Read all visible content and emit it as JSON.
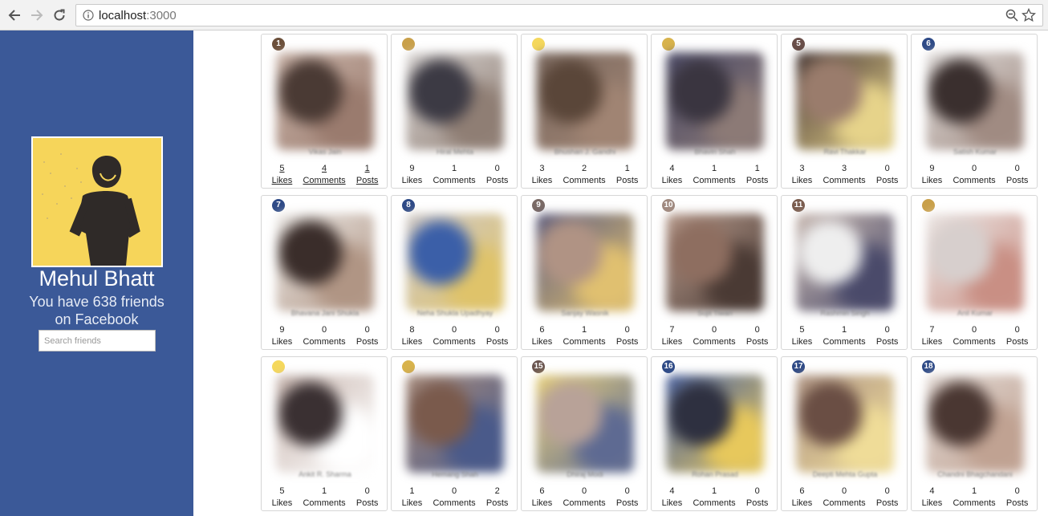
{
  "browser": {
    "url_host": "localhost",
    "url_port": ":3000"
  },
  "profile": {
    "name": "Mehul Bhatt",
    "friends_line1": "You have 638 friends",
    "friends_line2": "on Facebook",
    "search_placeholder": "Search friends"
  },
  "stat_labels": {
    "likes": "Likes",
    "comments": "Comments",
    "posts": "Posts"
  },
  "friends": [
    {
      "badge": "1",
      "badge_color": "#6b4f3a",
      "name": "Vikas Jain",
      "likes": "5",
      "comments": "4",
      "posts": "1",
      "linked": true,
      "palette": [
        "#4a3a34",
        "#9a7b6e",
        "#c9b3a8"
      ]
    },
    {
      "badge": "",
      "badge_color": "#c9a04a",
      "name": "Hiral Mehta",
      "likes": "9",
      "comments": "1",
      "posts": "0",
      "linked": false,
      "palette": [
        "#3c3a44",
        "#8f7e74",
        "#d8d4d2"
      ]
    },
    {
      "badge": "",
      "badge_color": "#f5d85c",
      "name": "Bhushan J. Gandhi",
      "likes": "3",
      "comments": "2",
      "posts": "1",
      "linked": false,
      "palette": [
        "#5a4639",
        "#a08473",
        "#7c6a60"
      ]
    },
    {
      "badge": "",
      "badge_color": "#d8b34c",
      "name": "Bhavin Shah",
      "likes": "4",
      "comments": "1",
      "posts": "1",
      "linked": false,
      "palette": [
        "#3a3540",
        "#8c7a76",
        "#4b4a66"
      ]
    },
    {
      "badge": "5",
      "badge_color": "#6a4f4a",
      "name": "Ravi Thakkar",
      "likes": "3",
      "comments": "3",
      "posts": "0",
      "linked": false,
      "palette": [
        "#9a7c6c",
        "#e6d38a",
        "#4a3a38"
      ]
    },
    {
      "badge": "6",
      "badge_color": "#2e4a86",
      "name": "Satish Kumar",
      "likes": "9",
      "comments": "0",
      "posts": "0",
      "linked": false,
      "palette": [
        "#3a2f2e",
        "#a08b82",
        "#dedad8"
      ]
    },
    {
      "badge": "7",
      "badge_color": "#2e4a86",
      "name": "Bhavana Jani Shukla",
      "likes": "9",
      "comments": "0",
      "posts": "0",
      "linked": false,
      "palette": [
        "#3a2d2a",
        "#b09584",
        "#ece9e6"
      ]
    },
    {
      "badge": "8",
      "badge_color": "#2e4a86",
      "name": "Neha Shukla Upadhyay",
      "likes": "8",
      "comments": "0",
      "posts": "0",
      "linked": false,
      "palette": [
        "#3b5fa8",
        "#dfc36a",
        "#cfc9c7"
      ]
    },
    {
      "badge": "9",
      "badge_color": "#7a6a66",
      "name": "Sanjay Wasnik",
      "likes": "6",
      "comments": "1",
      "posts": "0",
      "linked": false,
      "palette": [
        "#b09384",
        "#e0c070",
        "#5f5e7e"
      ]
    },
    {
      "badge": "10",
      "badge_color": "#a08a80",
      "name": "Sujit Tiwari",
      "likes": "7",
      "comments": "0",
      "posts": "0",
      "linked": false,
      "palette": [
        "#8e6e60",
        "#4a3a34",
        "#b69a8c"
      ]
    },
    {
      "badge": "11",
      "badge_color": "#7a5c4e",
      "name": "Rashmin Singh",
      "likes": "5",
      "comments": "1",
      "posts": "0",
      "linked": false,
      "palette": [
        "#eeeeee",
        "#4a4a6a",
        "#c8b8b0"
      ]
    },
    {
      "badge": "",
      "badge_color": "#c9a04a",
      "name": "Anil Kumar",
      "likes": "7",
      "comments": "0",
      "posts": "0",
      "linked": false,
      "palette": [
        "#d7cfcd",
        "#c98f84",
        "#ebe6e4"
      ]
    },
    {
      "badge": "",
      "badge_color": "#f5d85c",
      "name": "Ankit R. Sharma",
      "likes": "5",
      "comments": "1",
      "posts": "0",
      "linked": false,
      "palette": [
        "#3a3032",
        "#ffffff",
        "#c9b7b0"
      ]
    },
    {
      "badge": "",
      "badge_color": "#d8b34c",
      "name": "Hemang Shah",
      "likes": "1",
      "comments": "0",
      "posts": "2",
      "linked": false,
      "palette": [
        "#7a5a4c",
        "#4a5a8a",
        "#a88c7c"
      ]
    },
    {
      "badge": "15",
      "badge_color": "#6a5550",
      "name": "Dhiraj Modi",
      "likes": "6",
      "comments": "0",
      "posts": "0",
      "linked": false,
      "palette": [
        "#b8a298",
        "#5e6a92",
        "#e6cf7c"
      ]
    },
    {
      "badge": "16",
      "badge_color": "#2e4a86",
      "name": "Rohan Prasad",
      "likes": "4",
      "comments": "1",
      "posts": "0",
      "linked": false,
      "palette": [
        "#2e3040",
        "#e7c85c",
        "#4a62a0"
      ]
    },
    {
      "badge": "17",
      "badge_color": "#2e4a86",
      "name": "Deepti Mehta Gupta",
      "likes": "6",
      "comments": "0",
      "posts": "0",
      "linked": false,
      "palette": [
        "#6a4e44",
        "#efdc98",
        "#b09686"
      ]
    },
    {
      "badge": "18",
      "badge_color": "#2e4a86",
      "name": "Chandni Bhagchandani",
      "likes": "4",
      "comments": "1",
      "posts": "0",
      "linked": false,
      "palette": [
        "#4a3732",
        "#c0a292",
        "#e2d9d4"
      ]
    }
  ]
}
